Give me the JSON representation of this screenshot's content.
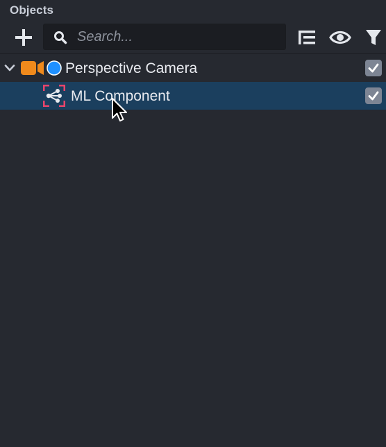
{
  "panel": {
    "title": "Objects"
  },
  "toolbar": {
    "add_icon": "plus-icon",
    "search": {
      "icon": "search-icon",
      "placeholder": "Search...",
      "value": ""
    },
    "icons": [
      "hierarchy-icon",
      "eye-icon",
      "filter-icon"
    ]
  },
  "tree": {
    "items": [
      {
        "label": "Perspective Camera",
        "expanded": true,
        "enabled": true,
        "icons": [
          "camera-icon",
          "layer-dot-icon"
        ],
        "selected": false
      },
      {
        "label": "ML Component",
        "enabled": true,
        "icons": [
          "ml-component-icon"
        ],
        "selected": true
      }
    ]
  },
  "colors": {
    "background": "#262930",
    "selection": "#1b3f5e",
    "camera_orange": "#f08a1c",
    "layer_blue": "#1e90ff",
    "ml_pink": "#e8456b",
    "checkbox": "#7d8594"
  }
}
